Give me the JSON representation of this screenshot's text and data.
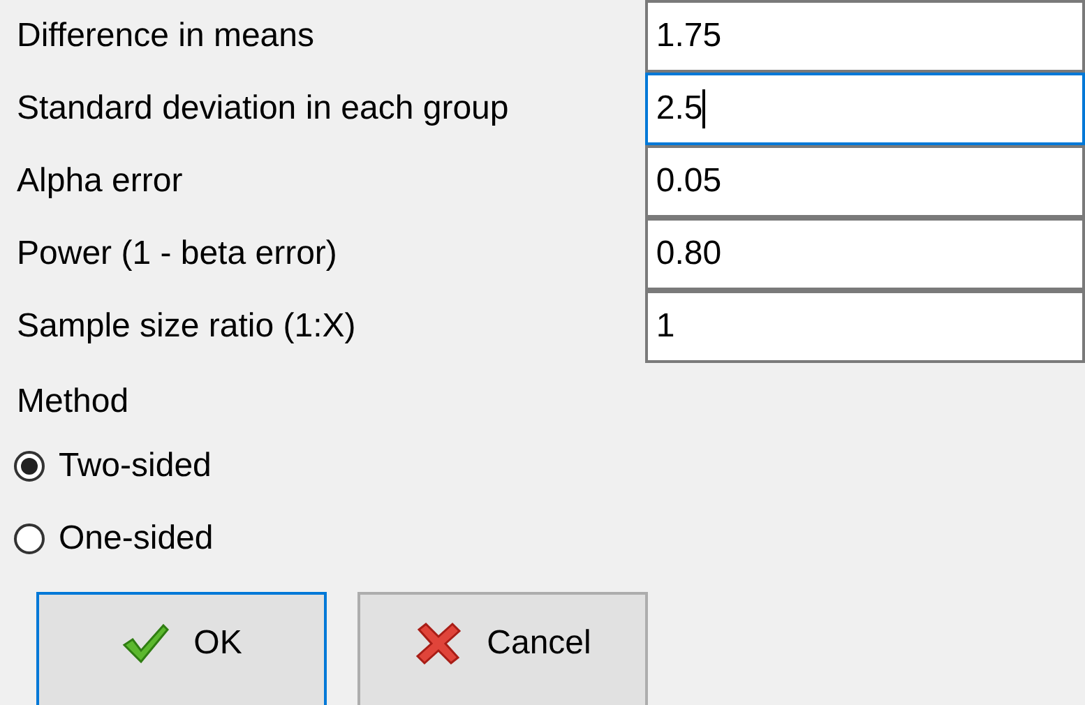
{
  "fields": [
    {
      "label": "Difference in means",
      "value": "1.75",
      "focused": false
    },
    {
      "label": "Standard deviation in each group",
      "value": "2.5",
      "focused": true
    },
    {
      "label": "Alpha error",
      "value": "0.05",
      "focused": false
    },
    {
      "label": "Power (1 - beta error)",
      "value": "0.80",
      "focused": false
    },
    {
      "label": "Sample size ratio (1:X)",
      "value": "1",
      "focused": false
    }
  ],
  "method": {
    "label": "Method",
    "options": [
      {
        "label": "Two-sided",
        "selected": true
      },
      {
        "label": "One-sided",
        "selected": false
      }
    ]
  },
  "buttons": [
    {
      "kind": "ok",
      "label": "OK",
      "focused": true
    },
    {
      "kind": "cancel",
      "label": "Cancel",
      "focused": false
    }
  ]
}
